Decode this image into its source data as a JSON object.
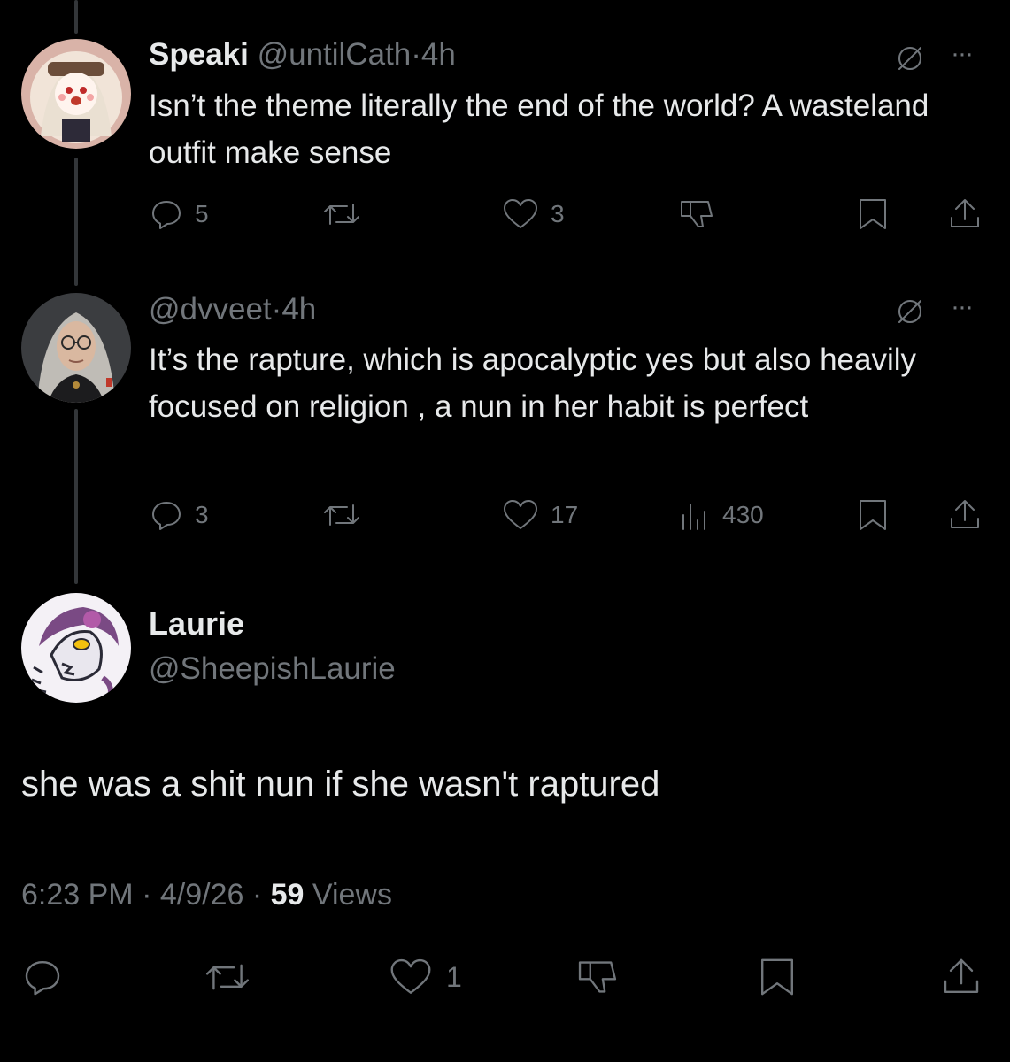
{
  "thread": [
    {
      "display_name": "Speaki",
      "handle": "@untilCath",
      "separator": "·",
      "time": "4h",
      "text": "Isn’t the theme literally the end of the world? A wasteland outfit make sense",
      "actions": {
        "replies": "5",
        "likes": "3"
      }
    },
    {
      "handle": "@dvveet",
      "separator": "·",
      "time": "4h",
      "text": "It’s the rapture, which is apocalyptic yes but also heavily focused on religion , a nun in her habit is perfect",
      "actions": {
        "replies": "3",
        "likes": "17",
        "views": "430"
      }
    }
  ],
  "main_post": {
    "display_name": "Laurie",
    "handle": "@SheepishLaurie",
    "text": "she was a shit nun if she wasn't raptured",
    "time": "6:23 PM",
    "sep1": "·",
    "date": "4/9/26",
    "sep2": "·",
    "views_count": "59",
    "views_label": "Views",
    "likes": "1"
  },
  "more_glyph": "···",
  "colors": {
    "background": "#000000",
    "text": "#e7e9ea",
    "muted": "#71767b",
    "thread_line": "#333639"
  }
}
